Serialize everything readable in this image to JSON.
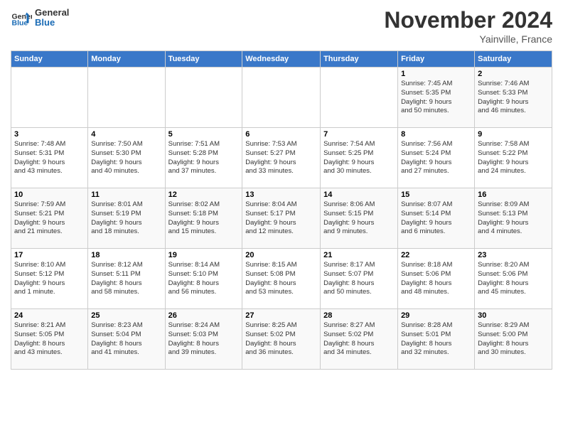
{
  "header": {
    "logo_text_general": "General",
    "logo_text_blue": "Blue",
    "month": "November 2024",
    "location": "Yainville, France"
  },
  "weekdays": [
    "Sunday",
    "Monday",
    "Tuesday",
    "Wednesday",
    "Thursday",
    "Friday",
    "Saturday"
  ],
  "weeks": [
    [
      {
        "day": "",
        "info": ""
      },
      {
        "day": "",
        "info": ""
      },
      {
        "day": "",
        "info": ""
      },
      {
        "day": "",
        "info": ""
      },
      {
        "day": "",
        "info": ""
      },
      {
        "day": "1",
        "info": "Sunrise: 7:45 AM\nSunset: 5:35 PM\nDaylight: 9 hours\nand 50 minutes."
      },
      {
        "day": "2",
        "info": "Sunrise: 7:46 AM\nSunset: 5:33 PM\nDaylight: 9 hours\nand 46 minutes."
      }
    ],
    [
      {
        "day": "3",
        "info": "Sunrise: 7:48 AM\nSunset: 5:31 PM\nDaylight: 9 hours\nand 43 minutes."
      },
      {
        "day": "4",
        "info": "Sunrise: 7:50 AM\nSunset: 5:30 PM\nDaylight: 9 hours\nand 40 minutes."
      },
      {
        "day": "5",
        "info": "Sunrise: 7:51 AM\nSunset: 5:28 PM\nDaylight: 9 hours\nand 37 minutes."
      },
      {
        "day": "6",
        "info": "Sunrise: 7:53 AM\nSunset: 5:27 PM\nDaylight: 9 hours\nand 33 minutes."
      },
      {
        "day": "7",
        "info": "Sunrise: 7:54 AM\nSunset: 5:25 PM\nDaylight: 9 hours\nand 30 minutes."
      },
      {
        "day": "8",
        "info": "Sunrise: 7:56 AM\nSunset: 5:24 PM\nDaylight: 9 hours\nand 27 minutes."
      },
      {
        "day": "9",
        "info": "Sunrise: 7:58 AM\nSunset: 5:22 PM\nDaylight: 9 hours\nand 24 minutes."
      }
    ],
    [
      {
        "day": "10",
        "info": "Sunrise: 7:59 AM\nSunset: 5:21 PM\nDaylight: 9 hours\nand 21 minutes."
      },
      {
        "day": "11",
        "info": "Sunrise: 8:01 AM\nSunset: 5:19 PM\nDaylight: 9 hours\nand 18 minutes."
      },
      {
        "day": "12",
        "info": "Sunrise: 8:02 AM\nSunset: 5:18 PM\nDaylight: 9 hours\nand 15 minutes."
      },
      {
        "day": "13",
        "info": "Sunrise: 8:04 AM\nSunset: 5:17 PM\nDaylight: 9 hours\nand 12 minutes."
      },
      {
        "day": "14",
        "info": "Sunrise: 8:06 AM\nSunset: 5:15 PM\nDaylight: 9 hours\nand 9 minutes."
      },
      {
        "day": "15",
        "info": "Sunrise: 8:07 AM\nSunset: 5:14 PM\nDaylight: 9 hours\nand 6 minutes."
      },
      {
        "day": "16",
        "info": "Sunrise: 8:09 AM\nSunset: 5:13 PM\nDaylight: 9 hours\nand 4 minutes."
      }
    ],
    [
      {
        "day": "17",
        "info": "Sunrise: 8:10 AM\nSunset: 5:12 PM\nDaylight: 9 hours\nand 1 minute."
      },
      {
        "day": "18",
        "info": "Sunrise: 8:12 AM\nSunset: 5:11 PM\nDaylight: 8 hours\nand 58 minutes."
      },
      {
        "day": "19",
        "info": "Sunrise: 8:14 AM\nSunset: 5:10 PM\nDaylight: 8 hours\nand 56 minutes."
      },
      {
        "day": "20",
        "info": "Sunrise: 8:15 AM\nSunset: 5:08 PM\nDaylight: 8 hours\nand 53 minutes."
      },
      {
        "day": "21",
        "info": "Sunrise: 8:17 AM\nSunset: 5:07 PM\nDaylight: 8 hours\nand 50 minutes."
      },
      {
        "day": "22",
        "info": "Sunrise: 8:18 AM\nSunset: 5:06 PM\nDaylight: 8 hours\nand 48 minutes."
      },
      {
        "day": "23",
        "info": "Sunrise: 8:20 AM\nSunset: 5:06 PM\nDaylight: 8 hours\nand 45 minutes."
      }
    ],
    [
      {
        "day": "24",
        "info": "Sunrise: 8:21 AM\nSunset: 5:05 PM\nDaylight: 8 hours\nand 43 minutes."
      },
      {
        "day": "25",
        "info": "Sunrise: 8:23 AM\nSunset: 5:04 PM\nDaylight: 8 hours\nand 41 minutes."
      },
      {
        "day": "26",
        "info": "Sunrise: 8:24 AM\nSunset: 5:03 PM\nDaylight: 8 hours\nand 39 minutes."
      },
      {
        "day": "27",
        "info": "Sunrise: 8:25 AM\nSunset: 5:02 PM\nDaylight: 8 hours\nand 36 minutes."
      },
      {
        "day": "28",
        "info": "Sunrise: 8:27 AM\nSunset: 5:02 PM\nDaylight: 8 hours\nand 34 minutes."
      },
      {
        "day": "29",
        "info": "Sunrise: 8:28 AM\nSunset: 5:01 PM\nDaylight: 8 hours\nand 32 minutes."
      },
      {
        "day": "30",
        "info": "Sunrise: 8:29 AM\nSunset: 5:00 PM\nDaylight: 8 hours\nand 30 minutes."
      }
    ]
  ]
}
